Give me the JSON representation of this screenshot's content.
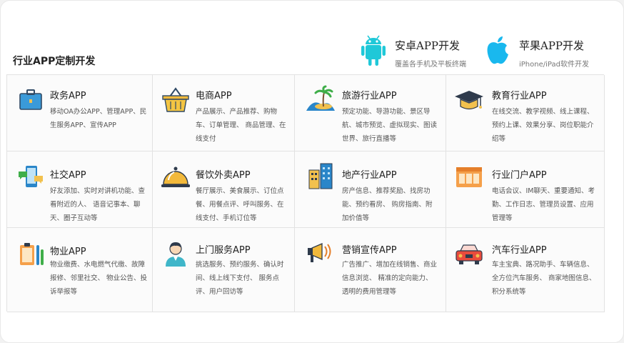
{
  "section_title": "行业APP定制开发",
  "platforms": [
    {
      "icon": "android-icon",
      "title": "安卓APP开发",
      "subtitle": "覆盖各手机及平板终端",
      "color": "#1fc8d8"
    },
    {
      "icon": "apple-icon",
      "title": "苹果APP开发",
      "subtitle": "iPhone/iPad软件开发",
      "color": "#19b8ee"
    }
  ],
  "industries": [
    {
      "icon": "briefcase-icon",
      "title": "政务APP",
      "desc": "移动OA办公APP、管理APP、民生服务APP、宣传APP"
    },
    {
      "icon": "shopping-basket-icon",
      "title": "电商APP",
      "desc": "产品展示、产品推荐、购物车、订单管理、 商品管理、在线支付"
    },
    {
      "icon": "island-icon",
      "title": "旅游行业APP",
      "desc": "预定功能、导游功能、景区导航、城市预览、虚拟现实、图读世界、旅行直播等"
    },
    {
      "icon": "graduation-cap-icon",
      "title": "教育行业APP",
      "desc": "在线交流、教学视频、线上课程、预约上课、效果分享、岗位职能介绍等"
    },
    {
      "icon": "chat-phone-icon",
      "title": "社交APP",
      "desc": "好友添加、实时对讲机功能、查看附近的人、 语音记事本、聊天、圈子互动等"
    },
    {
      "icon": "food-cloche-icon",
      "title": "餐饮外卖APP",
      "desc": "餐厅展示、美食展示、订位点餐、用餐点评、呼叫服务、在线支付、手机订位等"
    },
    {
      "icon": "buildings-icon",
      "title": "地产行业APP",
      "desc": "房产信息、推荐奖励、找房功能、预约看房、 购房指南、附加价值等"
    },
    {
      "icon": "portal-icon",
      "title": "行业门户APP",
      "desc": "电话会议、IM聊天、重要通知、考勤、工作日志、管理员设置、应用管理等"
    },
    {
      "icon": "property-tools-icon",
      "title": "物业APP",
      "desc": "物业缴费、水电燃气代缴、故障报修、邻里社交、 物业公告、投诉举报等"
    },
    {
      "icon": "service-agent-icon",
      "title": "上门服务APP",
      "desc": "挑选服务、预约服务、确认时间、线上线下支付、 服务点评、用户回访等"
    },
    {
      "icon": "megaphone-icon",
      "title": "营销宣传APP",
      "desc": "广告推广、增加在线销售、商业信息浏览、 精准的定向能力、透明的费用管理等"
    },
    {
      "icon": "car-icon",
      "title": "汽车行业APP",
      "desc": "车主宝典、路况助手、车辆信息、全方位汽车服务、 商家地图信息、积分系统等"
    }
  ]
}
